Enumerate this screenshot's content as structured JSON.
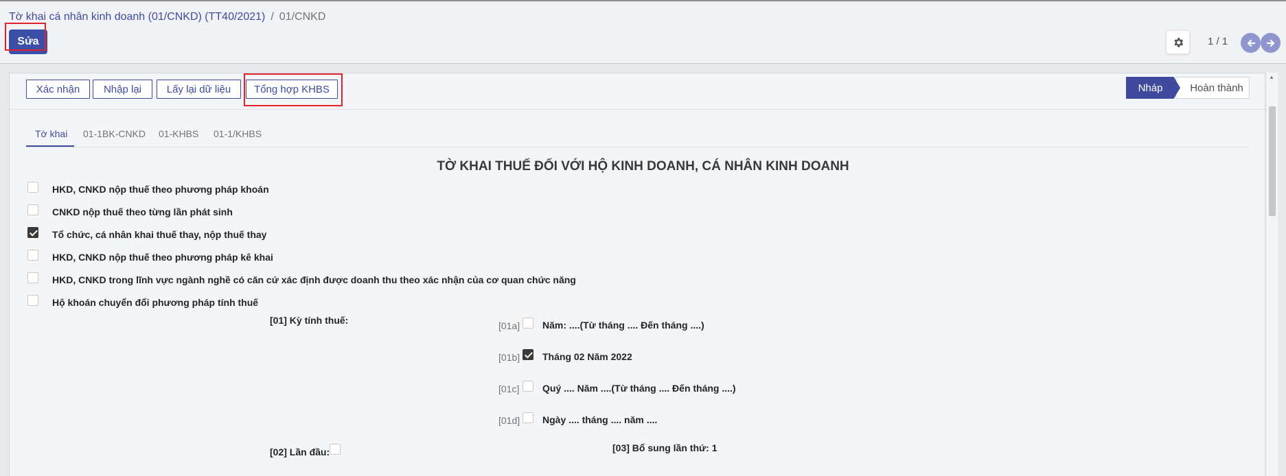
{
  "breadcrumb": {
    "parent": "Tờ khai cá nhân kinh doanh (01/CNKD) (TT40/2021)",
    "separator": "/",
    "current": "01/CNKD"
  },
  "toolbar": {
    "edit_label": "Sửa",
    "pager_value": "1 / 1"
  },
  "header_buttons": {
    "confirm": "Xác nhận",
    "reset": "Nhập lại",
    "reload": "Lấy lại dữ liệu",
    "summary": "Tổng hợp KHBS"
  },
  "status": {
    "draft": "Nháp",
    "done": "Hoàn thành",
    "active": "Nháp"
  },
  "tabs": [
    {
      "label": "Tờ khai",
      "active": true
    },
    {
      "label": "01-1BK-CNKD",
      "active": false
    },
    {
      "label": "01-KHBS",
      "active": false
    },
    {
      "label": "01-1/KHBS",
      "active": false
    }
  ],
  "form": {
    "title": "TỜ KHAI THUẾ ĐỐI VỚI HỘ KINH DOANH, CÁ NHÂN KINH DOANH",
    "options": [
      {
        "label": "HKD, CNKD nộp thuế theo phương pháp khoán",
        "checked": false
      },
      {
        "label": "CNKD nộp thuế theo từng lần phát sinh",
        "checked": false
      },
      {
        "label": "Tổ chức, cá nhân khai thuế thay, nộp thuế thay",
        "checked": true
      },
      {
        "label": "HKD, CNKD nộp thuế theo phương pháp kê khai",
        "checked": false
      },
      {
        "label": "HKD, CNKD trong lĩnh vực ngành nghề có căn cứ xác định được doanh thu theo xác nhận của cơ quan chức năng",
        "checked": false
      },
      {
        "label": "Hộ khoán chuyển đổi phương pháp tính thuế",
        "checked": false
      }
    ],
    "period_label": "[01] Kỳ tính thuế:",
    "periods": [
      {
        "code": "[01a]",
        "label": "Năm: ....(Từ tháng .... Đến tháng ....)",
        "checked": false
      },
      {
        "code": "[01b]",
        "label": "Tháng 02 Năm 2022",
        "checked": true
      },
      {
        "code": "[01c]",
        "label": "Quý .... Năm ....(Từ tháng .... Đến tháng ....)",
        "checked": false
      },
      {
        "code": "[01d]",
        "label": "Ngày .... tháng .... năm ....",
        "checked": false
      }
    ],
    "first_time_label": "[02] Lần đầu:",
    "first_time_checked": false,
    "supplement_label": "[03] Bổ sung lần thứ: 1"
  },
  "colors": {
    "primary": "#3f4a9c",
    "highlight": "#e2232b"
  }
}
